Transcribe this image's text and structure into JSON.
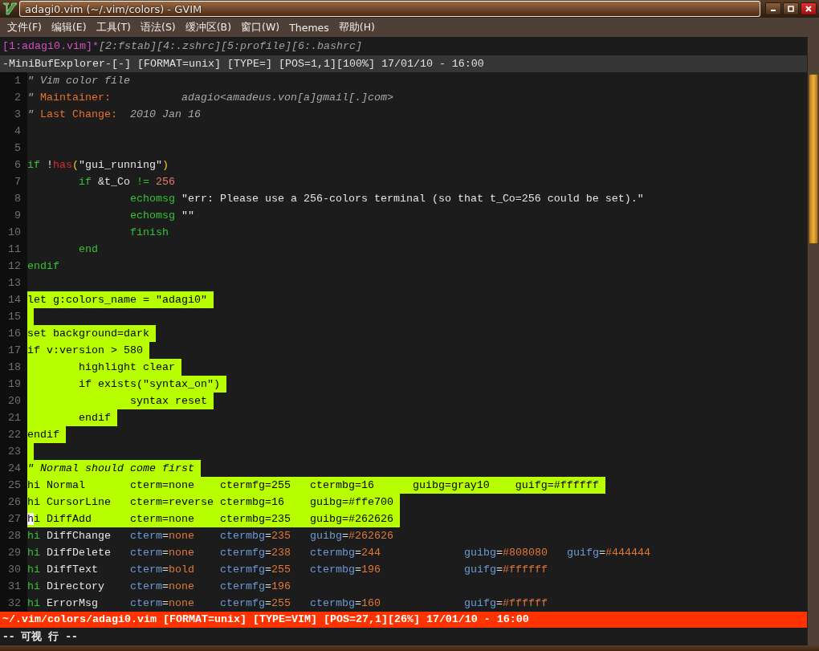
{
  "window": {
    "title": "adagi0.vim (~/.vim/colors) - GVIM"
  },
  "menu": [
    "文件(F)",
    "编辑(E)",
    "工具(T)",
    "语法(S)",
    "缓冲区(B)",
    "窗口(W)",
    "Themes",
    "帮助(H)"
  ],
  "buffers": [
    {
      "label": "[1:adagi0.vim]",
      "modified_mark": "*",
      "selected": true
    },
    {
      "label": "[2:fstab]",
      "selected": false
    },
    {
      "label": "[4:.zshrc]",
      "selected": false
    },
    {
      "label": "[5:profile]",
      "selected": false
    },
    {
      "label": "[6:.bashrc]",
      "selected": false
    }
  ],
  "explorer_status": "-MiniBufExplorer-[-] [FORMAT=unix] [TYPE=] [POS=1,1][100%] 17/01/10 - 16:00",
  "lines": [
    {
      "number": "1",
      "selected": false,
      "tokens": [
        {
          "text": "\" Vim color file",
          "kind": "comment"
        }
      ]
    },
    {
      "number": "2",
      "selected": false,
      "tokens": [
        {
          "text": "\"",
          "kind": "comment"
        },
        {
          "text": " Maintainer:           ",
          "kind": "label"
        },
        {
          "text": "adagio<amadeus.von[a]gmail[.]com>",
          "kind": "comment"
        }
      ]
    },
    {
      "number": "3",
      "selected": false,
      "tokens": [
        {
          "text": "\"",
          "kind": "comment"
        },
        {
          "text": " Last Change:  ",
          "kind": "label"
        },
        {
          "text": "2010 Jan 16",
          "kind": "comment"
        }
      ]
    },
    {
      "number": "4",
      "selected": false
    },
    {
      "number": "5",
      "selected": false
    },
    {
      "number": "6",
      "selected": false,
      "tokens": [
        {
          "text": "if",
          "kind": "keyword"
        },
        {
          "text": " !",
          "kind": "plain"
        },
        {
          "text": "has",
          "kind": "func"
        },
        {
          "text": "(",
          "kind": "paren"
        },
        {
          "text": "\"gui_running\"",
          "kind": "string"
        },
        {
          "text": ")",
          "kind": "paren"
        }
      ]
    },
    {
      "number": "7",
      "selected": false,
      "tokens": [
        {
          "text": "        if",
          "kind": "keyword"
        },
        {
          "text": " &t_Co ",
          "kind": "plain"
        },
        {
          "text": "!= ",
          "kind": "keyword"
        },
        {
          "text": "256",
          "kind": "number"
        }
      ]
    },
    {
      "number": "8",
      "selected": false,
      "tokens": [
        {
          "text": "                echomsg",
          "kind": "keyword"
        },
        {
          "text": " \"err: Please use a 256-colors terminal (so that t_Co=256 could be set).\"",
          "kind": "string"
        }
      ]
    },
    {
      "number": "9",
      "selected": false,
      "tokens": [
        {
          "text": "                echomsg",
          "kind": "keyword"
        },
        {
          "text": " \"\"",
          "kind": "string"
        }
      ]
    },
    {
      "number": "10",
      "selected": false,
      "tokens": [
        {
          "text": "                finish",
          "kind": "keyword"
        }
      ]
    },
    {
      "number": "11",
      "selected": false,
      "tokens": [
        {
          "text": "        end",
          "kind": "keyword"
        }
      ]
    },
    {
      "number": "12",
      "selected": false,
      "tokens": [
        {
          "text": "endif",
          "kind": "keyword"
        }
      ]
    },
    {
      "number": "13",
      "selected": false
    },
    {
      "number": "14",
      "selected": true,
      "tokens": [
        {
          "text": "let g:colors_name = \"adagi0\"",
          "kind": "plain"
        }
      ]
    },
    {
      "number": "15",
      "selected": true
    },
    {
      "number": "16",
      "selected": true,
      "tokens": [
        {
          "text": "set background=dark",
          "kind": "plain"
        }
      ]
    },
    {
      "number": "17",
      "selected": true,
      "tokens": [
        {
          "text": "if v:version > 580",
          "kind": "plain"
        }
      ]
    },
    {
      "number": "18",
      "selected": true,
      "tokens": [
        {
          "text": "        highlight clear",
          "kind": "plain"
        }
      ]
    },
    {
      "number": "19",
      "selected": true,
      "tokens": [
        {
          "text": "        if exists(\"syntax_on\")",
          "kind": "plain"
        }
      ]
    },
    {
      "number": "20",
      "selected": true,
      "tokens": [
        {
          "text": "                syntax reset",
          "kind": "plain"
        }
      ]
    },
    {
      "number": "21",
      "selected": true,
      "tokens": [
        {
          "text": "        endif",
          "kind": "plain"
        }
      ]
    },
    {
      "number": "22",
      "selected": true,
      "tokens": [
        {
          "text": "endif",
          "kind": "plain"
        }
      ]
    },
    {
      "number": "23",
      "selected": true
    },
    {
      "number": "24",
      "selected": true,
      "tokens": [
        {
          "text": "\" Normal should come first",
          "kind": "comment"
        }
      ]
    },
    {
      "number": "25",
      "selected": true,
      "tokens": [
        {
          "text": "hi Normal       cterm=none    ctermfg=255   ctermbg=16      guibg=gray10    guifg=#ffffff",
          "kind": "plain"
        }
      ]
    },
    {
      "number": "26",
      "selected": true,
      "tokens": [
        {
          "text": "hi CursorLine   cterm=reverse ctermbg=16    guibg=#ffe700",
          "kind": "plain"
        }
      ]
    },
    {
      "number": "27",
      "selected": true,
      "tokens": [
        {
          "text": "h",
          "kind": "plain",
          "cursor": true
        },
        {
          "text": "i DiffAdd      cterm=none    ctermbg=235   guibg=#262626",
          "kind": "plain"
        }
      ]
    },
    {
      "number": "28",
      "selected": false,
      "tokens": [
        {
          "text": "hi",
          "kind": "keyword"
        },
        {
          "text": " DiffChange   ",
          "kind": "plain"
        },
        {
          "text": "cterm",
          "kind": "attr"
        },
        {
          "text": "=",
          "kind": "plain"
        },
        {
          "text": "none    ",
          "kind": "value"
        },
        {
          "text": "ctermbg",
          "kind": "attr"
        },
        {
          "text": "=",
          "kind": "plain"
        },
        {
          "text": "235   ",
          "kind": "value"
        },
        {
          "text": "guibg",
          "kind": "attr"
        },
        {
          "text": "=",
          "kind": "plain"
        },
        {
          "text": "#262626",
          "kind": "value"
        }
      ]
    },
    {
      "number": "29",
      "selected": false,
      "tokens": [
        {
          "text": "hi",
          "kind": "keyword"
        },
        {
          "text": " DiffDelete   ",
          "kind": "plain"
        },
        {
          "text": "cterm",
          "kind": "attr"
        },
        {
          "text": "=",
          "kind": "plain"
        },
        {
          "text": "none    ",
          "kind": "value"
        },
        {
          "text": "ctermfg",
          "kind": "attr"
        },
        {
          "text": "=",
          "kind": "plain"
        },
        {
          "text": "238   ",
          "kind": "value"
        },
        {
          "text": "ctermbg",
          "kind": "attr"
        },
        {
          "text": "=",
          "kind": "plain"
        },
        {
          "text": "244             ",
          "kind": "value"
        },
        {
          "text": "guibg",
          "kind": "attr"
        },
        {
          "text": "=",
          "kind": "plain"
        },
        {
          "text": "#808080   ",
          "kind": "value"
        },
        {
          "text": "guifg",
          "kind": "attr"
        },
        {
          "text": "=",
          "kind": "plain"
        },
        {
          "text": "#444444",
          "kind": "value"
        }
      ]
    },
    {
      "number": "30",
      "selected": false,
      "tokens": [
        {
          "text": "hi",
          "kind": "keyword"
        },
        {
          "text": " DiffText     ",
          "kind": "plain"
        },
        {
          "text": "cterm",
          "kind": "attr"
        },
        {
          "text": "=",
          "kind": "plain"
        },
        {
          "text": "bold    ",
          "kind": "value"
        },
        {
          "text": "ctermfg",
          "kind": "attr"
        },
        {
          "text": "=",
          "kind": "plain"
        },
        {
          "text": "255   ",
          "kind": "value"
        },
        {
          "text": "ctermbg",
          "kind": "attr"
        },
        {
          "text": "=",
          "kind": "plain"
        },
        {
          "text": "196             ",
          "kind": "value"
        },
        {
          "text": "guifg",
          "kind": "attr"
        },
        {
          "text": "=",
          "kind": "plain"
        },
        {
          "text": "#ffffff",
          "kind": "value"
        }
      ]
    },
    {
      "number": "31",
      "selected": false,
      "tokens": [
        {
          "text": "hi",
          "kind": "keyword"
        },
        {
          "text": " Directory    ",
          "kind": "plain"
        },
        {
          "text": "cterm",
          "kind": "attr"
        },
        {
          "text": "=",
          "kind": "plain"
        },
        {
          "text": "none    ",
          "kind": "value"
        },
        {
          "text": "ctermfg",
          "kind": "attr"
        },
        {
          "text": "=",
          "kind": "plain"
        },
        {
          "text": "196",
          "kind": "value"
        }
      ]
    },
    {
      "number": "32",
      "selected": false,
      "tokens": [
        {
          "text": "hi",
          "kind": "keyword"
        },
        {
          "text": " ErrorMsg     ",
          "kind": "plain"
        },
        {
          "text": "cterm",
          "kind": "attr"
        },
        {
          "text": "=",
          "kind": "plain"
        },
        {
          "text": "none    ",
          "kind": "value"
        },
        {
          "text": "ctermfg",
          "kind": "attr"
        },
        {
          "text": "=",
          "kind": "plain"
        },
        {
          "text": "255   ",
          "kind": "value"
        },
        {
          "text": "ctermbg",
          "kind": "attr"
        },
        {
          "text": "=",
          "kind": "plain"
        },
        {
          "text": "160             ",
          "kind": "value"
        },
        {
          "text": "guifg",
          "kind": "attr"
        },
        {
          "text": "=",
          "kind": "plain"
        },
        {
          "text": "#ffffff",
          "kind": "value"
        }
      ]
    }
  ],
  "status_line": "~/.vim/colors/adagi0.vim [FORMAT=unix] [TYPE=VIM] [POS=27,1][26%] 17/01/10 - 16:00",
  "command_line": "-- 可视 行 --"
}
